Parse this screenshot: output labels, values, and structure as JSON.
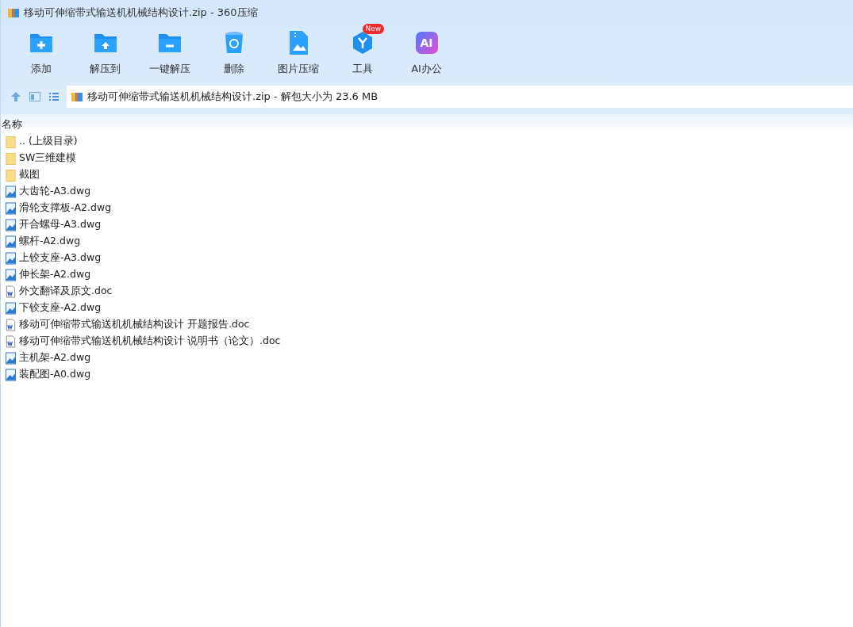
{
  "window": {
    "title": "移动可伸缩带式输送机机械结构设计.zip - 360压缩"
  },
  "toolbar": [
    {
      "kind": "add",
      "label": "添加"
    },
    {
      "kind": "extract",
      "label": "解压到"
    },
    {
      "kind": "oneclick",
      "label": "一键解压"
    },
    {
      "kind": "delete",
      "label": "删除"
    },
    {
      "kind": "image",
      "label": "图片压缩"
    },
    {
      "kind": "tools",
      "label": "工具",
      "badge": "New"
    },
    {
      "kind": "ai",
      "label": "AI办公",
      "icon_text": "AI"
    }
  ],
  "address": {
    "text": "移动可伸缩带式输送机机械结构设计.zip - 解包大小为 23.6 MB"
  },
  "table": {
    "columns": [
      "名称"
    ],
    "rows": [
      {
        "kind": "folder",
        "name": ".. (上级目录)"
      },
      {
        "kind": "folder",
        "name": "SW三维建模"
      },
      {
        "kind": "folder",
        "name": "截图"
      },
      {
        "kind": "dwg",
        "name": "大齿轮-A3.dwg"
      },
      {
        "kind": "dwg",
        "name": "滑轮支撑板-A2.dwg"
      },
      {
        "kind": "dwg",
        "name": "开合螺母-A3.dwg"
      },
      {
        "kind": "dwg",
        "name": "螺杆-A2.dwg"
      },
      {
        "kind": "dwg",
        "name": "上铰支座-A3.dwg"
      },
      {
        "kind": "dwg",
        "name": "伸长架-A2.dwg"
      },
      {
        "kind": "doc",
        "name": "外文翻译及原文.doc"
      },
      {
        "kind": "dwg",
        "name": "下铰支座-A2.dwg"
      },
      {
        "kind": "doc",
        "name": "移动可伸缩带式输送机机械结构设计 开题报告.doc"
      },
      {
        "kind": "doc",
        "name": "移动可伸缩带式输送机机械结构设计 说明书（论文）.doc"
      },
      {
        "kind": "dwg",
        "name": "主机架-A2.dwg"
      },
      {
        "kind": "dwg",
        "name": "装配图-A0.dwg"
      }
    ]
  }
}
